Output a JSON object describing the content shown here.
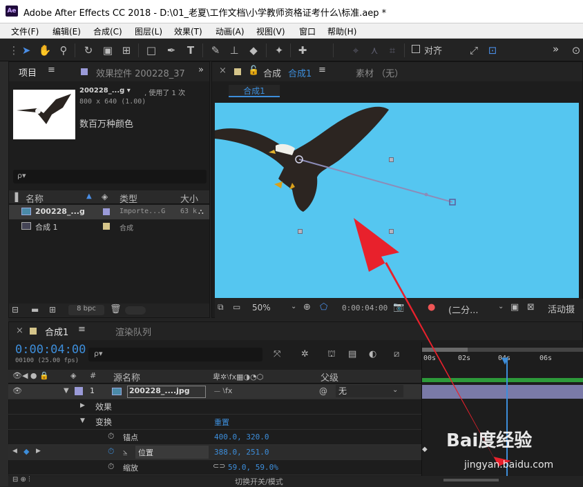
{
  "window": {
    "title": "Adobe After Effects CC 2018 - D:\\01_老夏\\工作文档\\小学教师资格证考什么\\标准.aep *",
    "logo": "Ae"
  },
  "menu": [
    "文件(F)",
    "编辑(E)",
    "合成(C)",
    "图层(L)",
    "效果(T)",
    "动画(A)",
    "视图(V)",
    "窗口",
    "帮助(H)"
  ],
  "toolbar": {
    "align_label": "对齐",
    "more": "»"
  },
  "project_panel": {
    "tab_label": "项目",
    "effects_tab": "效果控件 200228_37",
    "footage_name": "200228_...g ▾",
    "used_text": ", 使用了 1 次",
    "footage_info": "800 x 640 (1.00)",
    "color_text": "数百万种颜色",
    "search_placeholder": "ρ▾",
    "columns": {
      "name": "名称",
      "type": "类型",
      "size": "大小"
    },
    "items": [
      {
        "name": "200228_...g",
        "type": "Importe...G",
        "size": "63 k"
      },
      {
        "name": "合成 1",
        "type": "合成",
        "size": ""
      }
    ],
    "bpc": "8 bpc"
  },
  "comp_panel": {
    "tab_label": "合成",
    "tab_active": "合成1",
    "material_label": "素材 （无）",
    "sub_tab": "合成1",
    "zoom": "50%",
    "time": "0:00:04:00",
    "resolution": "(二分...",
    "active_camera": "活动摄"
  },
  "timeline": {
    "tab_label": "合成1",
    "render_queue": "渲染队列",
    "timecode": "0:00:04:00",
    "frames": "00100 (25.00 fps)",
    "search_placeholder": "ρ▾",
    "col_source": "源名称",
    "col_parent": "父级",
    "layer": {
      "index": "1",
      "name": "200228_....jpg",
      "parent": "无"
    },
    "groups": {
      "effects": "效果",
      "transform": "变换",
      "reset": "重置"
    },
    "props": [
      {
        "name": "锚点",
        "value": "400.0, 320.0"
      },
      {
        "name": "位置",
        "value": "388.0, 251.0"
      },
      {
        "name": "缩放",
        "value": "59.0, 59.0%"
      }
    ],
    "switches_label": "切换开关/模式",
    "ruler": [
      "00s",
      "02s",
      "04s",
      "06s"
    ]
  },
  "colors": {
    "accent_blue": "#3d8edb",
    "sky": "#55c6f0",
    "arrow": "#e8212c"
  },
  "watermark": {
    "brand": "Bai度经验",
    "url": "jingyan.baidu.com"
  }
}
